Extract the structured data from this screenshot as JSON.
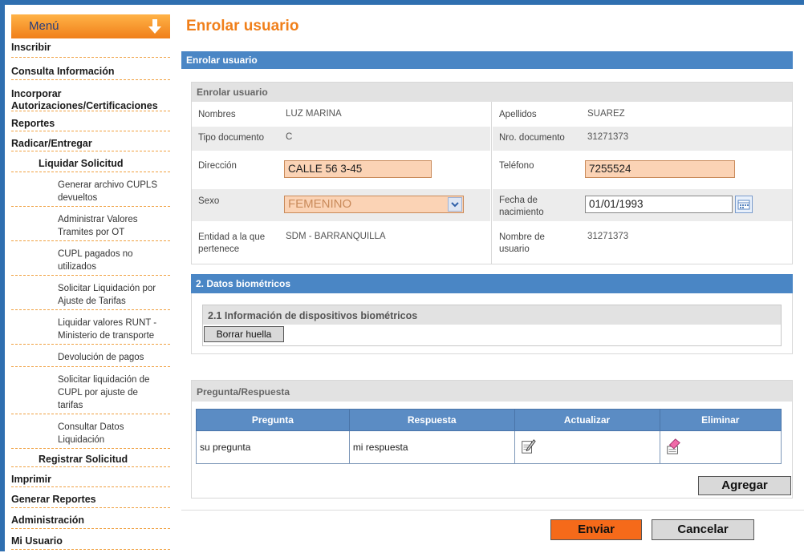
{
  "sidebar": {
    "menu_label": "Menú",
    "items": [
      {
        "label": "Inscribir"
      },
      {
        "label": "Consulta Información"
      },
      {
        "label": "Incorporar Autorizaciones/Certificaciones"
      },
      {
        "label": "Reportes"
      },
      {
        "label": "Radicar/Entregar"
      }
    ],
    "sub_liquidar": "Liquidar Solicitud",
    "liquidar_children": [
      "Generar archivo CUPLS devueltos",
      "Administrar Valores Tramites por OT",
      "CUPL pagados no utilizados",
      "Solicitar Liquidación por Ajuste de Tarifas",
      "Liquidar valores RUNT - Ministerio de transporte",
      "Devolución de pagos",
      "Solicitar liquidación de CUPL por ajuste de tarifas",
      "Consultar Datos Liquidación"
    ],
    "sub_registrar": "Registrar Solicitud",
    "bottom_items": [
      "Imprimir",
      "Generar Reportes",
      "Administración",
      "Mi Usuario"
    ]
  },
  "page": {
    "title": "Enrolar usuario",
    "section_bar": "Enrolar usuario"
  },
  "enrolar": {
    "panel_title": "Enrolar usuario",
    "nombres_label": "Nombres",
    "nombres_value": "LUZ MARINA",
    "apellidos_label": "Apellidos",
    "apellidos_value": "SUAREZ",
    "tipo_doc_label": "Tipo documento",
    "tipo_doc_value": "C",
    "nro_doc_label": "Nro. documento",
    "nro_doc_value": "31271373",
    "direccion_label": "Dirección",
    "direccion_value": "CALLE 56  3-45",
    "telefono_label": "Teléfono",
    "telefono_value": "7255524",
    "sexo_label": "Sexo",
    "sexo_value": "FEMENINO",
    "fecha_label": "Fecha de nacimiento",
    "fecha_value": "01/01/1993",
    "entidad_label": "Entidad a la que pertenece",
    "entidad_value": "SDM - BARRANQUILLA",
    "usuario_label": "Nombre de usuario",
    "usuario_value": "31271373"
  },
  "biometricos": {
    "bar_title": "2. Datos biométricos",
    "sub_title": "2.1 Información de dispositivos biométricos",
    "borrar_button": "Borrar huella"
  },
  "pregunta": {
    "panel_title": "Pregunta/Respuesta",
    "headers": [
      "Pregunta",
      "Respuesta",
      "Actualizar",
      "Eliminar"
    ],
    "rows": [
      {
        "pregunta": "su pregunta",
        "respuesta": "mi respuesta"
      }
    ],
    "agregar_button": "Agregar"
  },
  "actions": {
    "enviar": "Enviar",
    "cancelar": "Cancelar"
  },
  "colors": {
    "accent_orange": "#f07f1a",
    "bar_blue": "#4a86c5",
    "input_peach": "#fbd3b5"
  }
}
